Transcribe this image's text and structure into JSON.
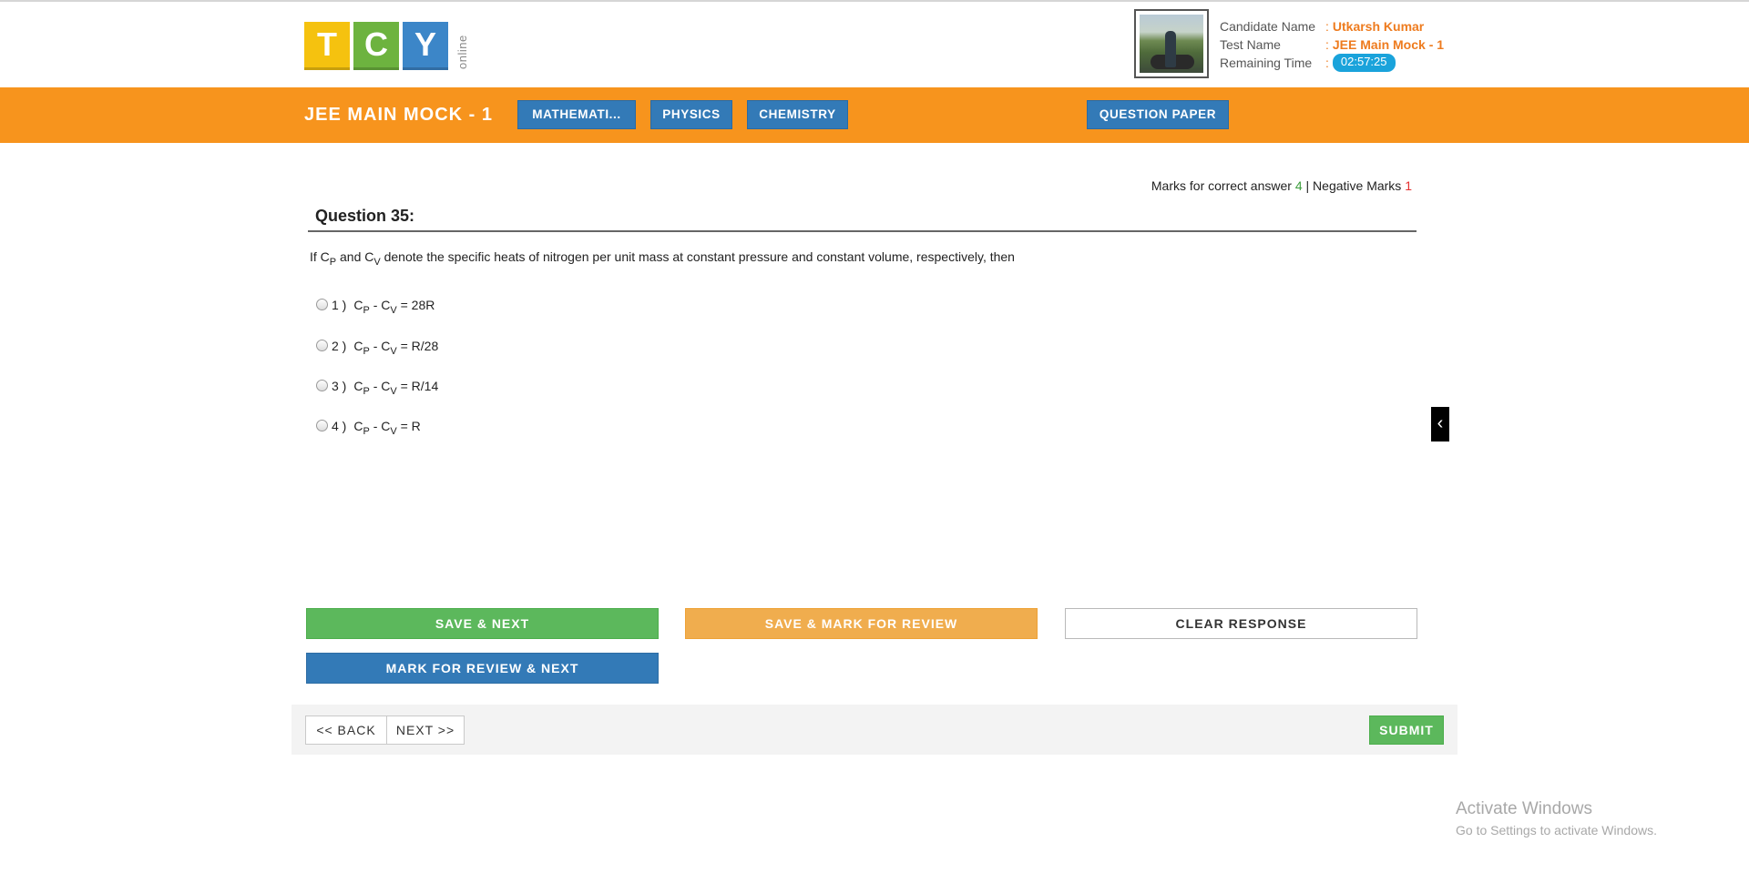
{
  "logo": {
    "letters": [
      "T",
      "C",
      "Y"
    ],
    "sub": "online"
  },
  "candidate": {
    "name_label": "Candidate Name",
    "name_value": "Utkarsh Kumar",
    "test_label": "Test Name",
    "test_value": "JEE Main Mock - 1",
    "time_label": "Remaining Time",
    "time_value": "02:57:25",
    "separator": ":"
  },
  "navbar": {
    "title": "JEE MAIN MOCK - 1",
    "subjects": [
      "MATHEMATI...",
      "PHYSICS",
      "CHEMISTRY"
    ],
    "question_paper": "QUESTION PAPER"
  },
  "marks": {
    "correct_label": "Marks for correct answer",
    "correct_value": "4",
    "divider": "|",
    "negative_label": "Negative Marks",
    "negative_value": "1"
  },
  "question": {
    "heading": "Question 35:",
    "text": {
      "p1": "If C",
      "s1": "P",
      "p2": " and C",
      "s2": "V",
      "p3": " denote the specific heats of nitrogen per unit mass at constant pressure and constant volume, respectively, then"
    },
    "options": [
      {
        "num": "1 )",
        "a": "C",
        "sa": "P",
        "b": " - C",
        "sb": "V",
        "c": " = 28R"
      },
      {
        "num": "2 )",
        "a": "C",
        "sa": "P",
        "b": " - C",
        "sb": "V",
        "c": " = R/28"
      },
      {
        "num": "3 )",
        "a": "C",
        "sa": "P",
        "b": " - C",
        "sb": "V",
        "c": " = R/14"
      },
      {
        "num": "4 )",
        "a": "C",
        "sa": "P",
        "b": " - C",
        "sb": "V",
        "c": " = R"
      }
    ]
  },
  "actions": {
    "save_next": "SAVE & NEXT",
    "save_review": "SAVE & MARK FOR REVIEW",
    "clear": "CLEAR RESPONSE",
    "review_next": "MARK FOR REVIEW & NEXT"
  },
  "footer": {
    "back": "<< BACK",
    "next": "NEXT >>",
    "submit": "SUBMIT"
  },
  "side_toggle": "‹",
  "watermark": {
    "line1": "Activate Windows",
    "line2": "Go to Settings to activate Windows."
  },
  "colors": {
    "orange": "#f7941d",
    "blue": "#337ab7",
    "green": "#5cb85c",
    "amber": "#f0ad4e",
    "timer": "#1aa3db"
  }
}
